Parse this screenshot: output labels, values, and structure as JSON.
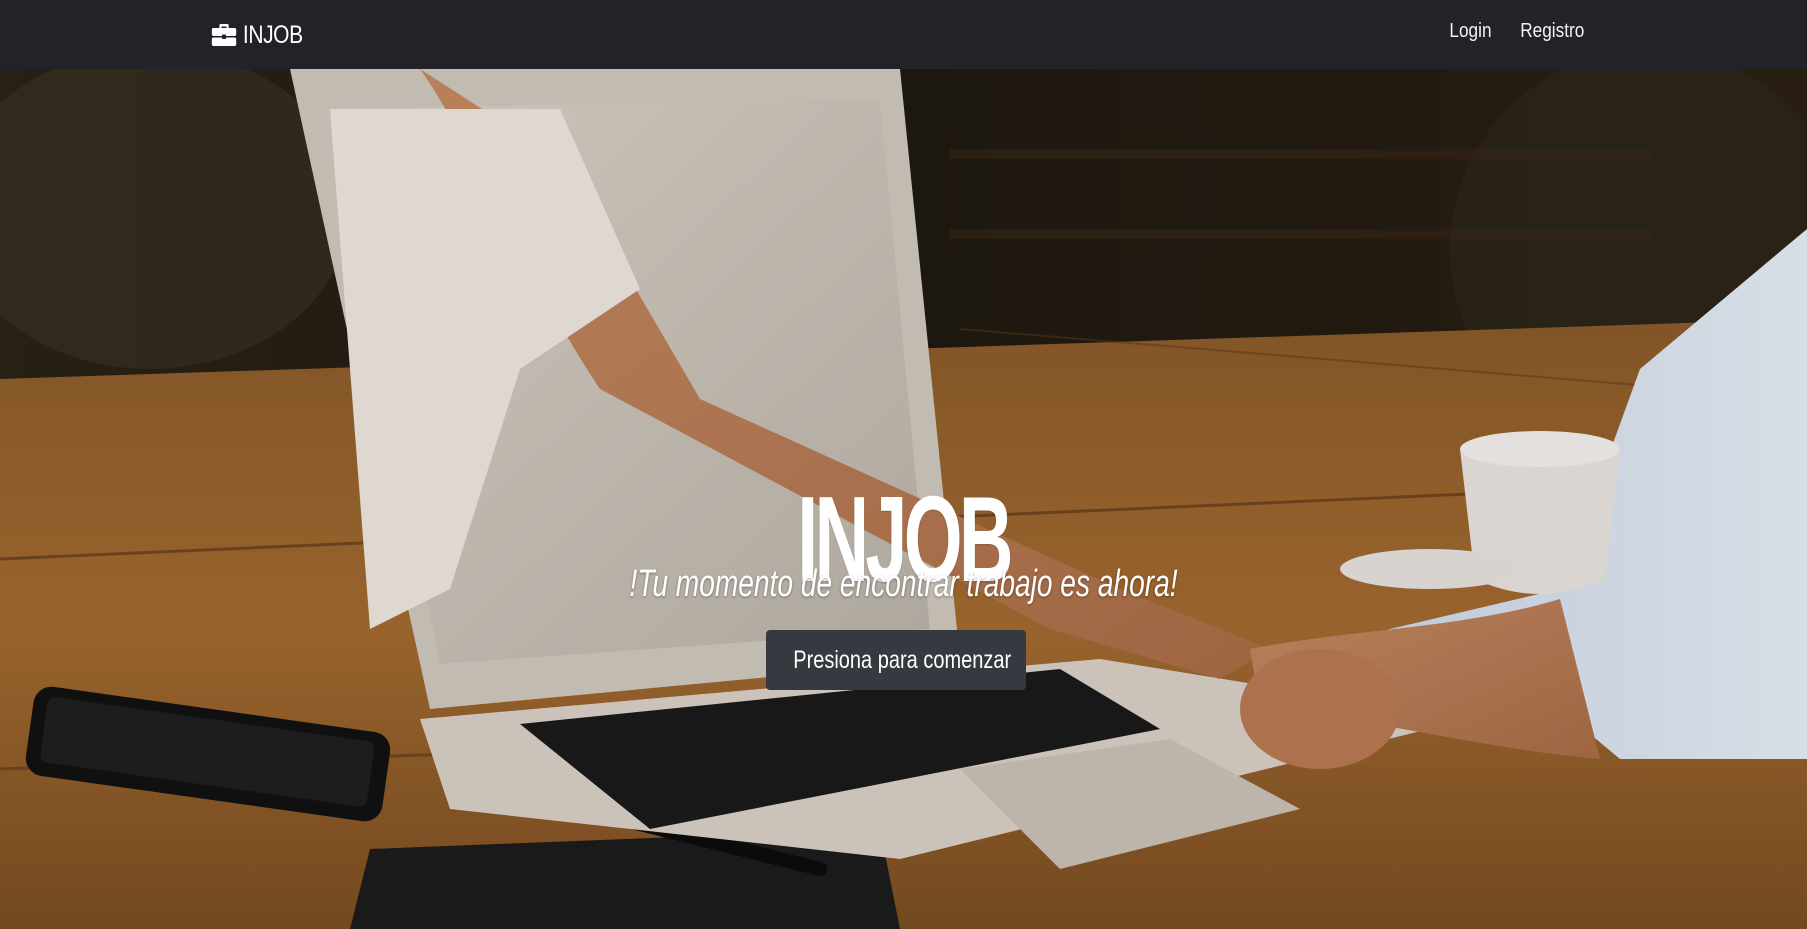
{
  "navbar": {
    "brand": "INJOB",
    "brand_icon": "briefcase-icon",
    "links": [
      {
        "label": "Login"
      },
      {
        "label": "Registro"
      }
    ],
    "background_color": "#212329"
  },
  "hero": {
    "title": "INJOB",
    "subtitle": "!Tu momento de encontrar trabajo es ahora!",
    "button_label": "Presiona para comenzar",
    "button_color": "#343a40",
    "background_image": "handshake-through-laptop-photo"
  }
}
